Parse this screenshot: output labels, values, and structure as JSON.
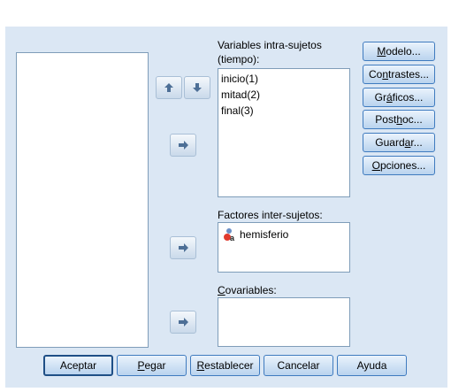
{
  "source_list": {
    "items": []
  },
  "within_subjects": {
    "label_line1": "Variables intra-sujetos",
    "label_line2": "(tiempo):",
    "items": [
      "inicio(1)",
      "mitad(2)",
      "final(3)"
    ]
  },
  "between_subjects": {
    "label": "Factores inter-sujetos:",
    "items": [
      {
        "icon": "nominal-variable-icon",
        "label": "hemisferio"
      }
    ]
  },
  "covariates": {
    "label_mnemonic": "C",
    "label_rest": "ovariables:"
  },
  "side_buttons": {
    "modelo": {
      "mn": "M",
      "rest": "odelo..."
    },
    "contrastes": {
      "pre": "Co",
      "mn": "n",
      "rest": "trastes..."
    },
    "graficos": {
      "pre": "Gr",
      "mn": "á",
      "rest": "ficos..."
    },
    "posthoc": {
      "pre": "Post ",
      "mn": "h",
      "rest": "oc..."
    },
    "guardar": {
      "pre": "Guard",
      "mn": "a",
      "rest": "r..."
    },
    "opciones": {
      "mn": "O",
      "rest": "pciones..."
    }
  },
  "bottom_buttons": {
    "aceptar": "Aceptar",
    "pegar": {
      "mn": "P",
      "rest": "egar"
    },
    "restablecer": {
      "mn": "R",
      "rest": "establecer"
    },
    "cancelar": "Cancelar",
    "ayuda": "Ayuda"
  },
  "colors": {
    "dialog_bg": "#dbe7f4",
    "button_border": "#3f7bbf",
    "arrow": "#4d6f96"
  }
}
